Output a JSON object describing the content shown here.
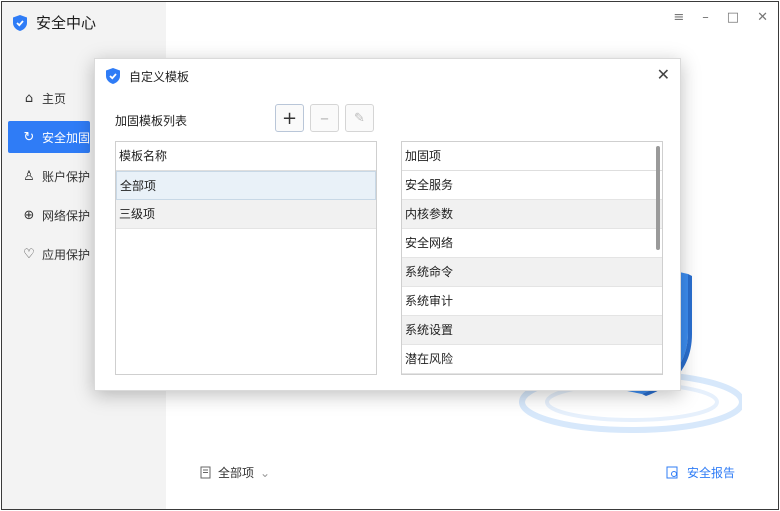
{
  "app": {
    "title": "安全中心"
  },
  "window_controls": {
    "menu_icon": "≡",
    "minimize_icon": "–",
    "maximize_icon": "□",
    "close_icon": "✕"
  },
  "sidebar": {
    "items": [
      {
        "label": "主页",
        "icon": "⌂"
      },
      {
        "label": "安全加固",
        "icon": "↻"
      },
      {
        "label": "账户保护",
        "icon": "♙"
      },
      {
        "label": "网络保护",
        "icon": "⊕"
      },
      {
        "label": "应用保护",
        "icon": "♡"
      }
    ]
  },
  "dialog": {
    "title": "自定义模板",
    "close_icon": "✕",
    "list_label": "加固模板列表",
    "add_icon": "+",
    "remove_icon": "–",
    "edit_icon": "✎",
    "left_table": {
      "header": "模板名称",
      "rows": [
        "全部项",
        "三级项"
      ]
    },
    "right_table": {
      "header": "加固项",
      "rows": [
        "安全服务",
        "内核参数",
        "安全网络",
        "系统命令",
        "系统审计",
        "系统设置",
        "潜在风险"
      ]
    }
  },
  "footer": {
    "scope_label": "全部项",
    "scope_chevron": "⌄",
    "report_label": "安全报告"
  },
  "colors": {
    "accent": "#2f7cf6",
    "sidebar_bg": "#f3f3f3"
  }
}
